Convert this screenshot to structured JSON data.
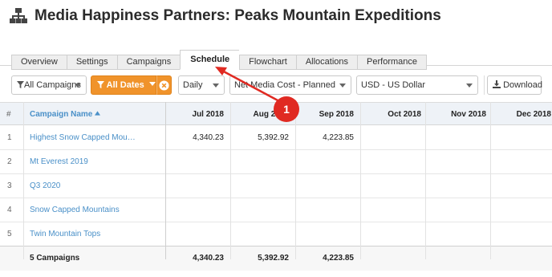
{
  "page": {
    "title": "Media Happiness Partners: Peaks Mountain Expeditions"
  },
  "tabs": [
    {
      "label": "Overview",
      "active": false
    },
    {
      "label": "Settings",
      "active": false
    },
    {
      "label": "Campaigns",
      "active": false
    },
    {
      "label": "Schedule",
      "active": true
    },
    {
      "label": "Flowchart",
      "active": false
    },
    {
      "label": "Allocations",
      "active": false
    },
    {
      "label": "Performance",
      "active": false
    }
  ],
  "toolbar": {
    "campaign_filter": "All Campaigns",
    "date_filter": "All Dates",
    "interval": "Daily",
    "cost_type": "Net Media Cost - Planned",
    "currency": "USD - US Dollar",
    "download_label": "Download"
  },
  "grid": {
    "columns": {
      "rownum": "#",
      "name": "Campaign Name",
      "months": [
        "Jul 2018",
        "Aug 2018",
        "Sep 2018",
        "Oct 2018",
        "Nov 2018",
        "Dec 2018"
      ]
    },
    "rows": [
      {
        "num": "1",
        "name": "Highest Snow Capped Mou…",
        "values": [
          "4,340.23",
          "5,392.92",
          "4,223.85",
          "",
          "",
          ""
        ]
      },
      {
        "num": "2",
        "name": "Mt Everest 2019",
        "values": [
          "",
          "",
          "",
          "",
          "",
          ""
        ]
      },
      {
        "num": "3",
        "name": "Q3 2020",
        "values": [
          "",
          "",
          "",
          "",
          "",
          ""
        ]
      },
      {
        "num": "4",
        "name": "Snow Capped Mountains",
        "values": [
          "",
          "",
          "",
          "",
          "",
          ""
        ]
      },
      {
        "num": "5",
        "name": "Twin Mountain Tops",
        "values": [
          "",
          "",
          "",
          "",
          "",
          ""
        ]
      }
    ],
    "totals": {
      "label": "5 Campaigns",
      "values": [
        "4,340.23",
        "5,392.92",
        "4,223.85",
        "",
        "",
        ""
      ]
    }
  },
  "annotation": {
    "number": "1"
  },
  "colors": {
    "accent": "#4a90c8",
    "orange": "#f0932b",
    "callout": "#e02a22"
  }
}
